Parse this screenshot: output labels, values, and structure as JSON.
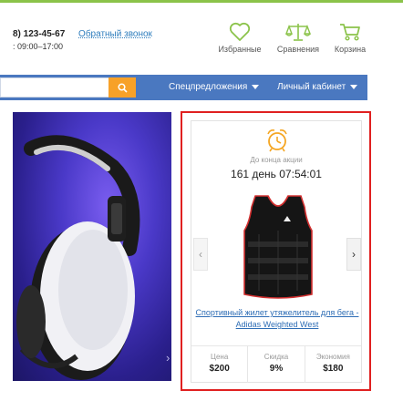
{
  "header": {
    "phone": "8) 123-45-67",
    "callback_link": "Обратный звонок",
    "hours": ": 09:00–17:00",
    "icons": [
      {
        "name": "heart-icon",
        "label": "Избранные"
      },
      {
        "name": "scales-icon",
        "label": "Сравнения"
      },
      {
        "name": "cart-icon",
        "label": "Корзина"
      }
    ]
  },
  "nav": {
    "search": {
      "value": "",
      "placeholder": ""
    },
    "search_button_icon": "search-icon",
    "items": [
      {
        "label": "Спецпредложения"
      },
      {
        "label": "Личный кабинет"
      }
    ]
  },
  "banner": {
    "arrow_glyph": "›"
  },
  "promo": {
    "until_label": "До конца акции",
    "timer": "161 день 07:54:01",
    "product_link": "Спортивный жилет утяжелитель для бега - Adidas Weighted West",
    "prev_glyph": "‹",
    "next_glyph": "›",
    "stats": [
      {
        "label": "Цена",
        "value": "$200"
      },
      {
        "label": "Скидка",
        "value": "9%"
      },
      {
        "label": "Экономия",
        "value": "$180"
      }
    ]
  },
  "colors": {
    "accent_green": "#8bc34a",
    "nav_blue": "#4a78c0",
    "search_orange": "#f7a128",
    "promo_border_red": "#e02020",
    "clock_orange": "#f5a623",
    "link_blue": "#2e6db5"
  }
}
